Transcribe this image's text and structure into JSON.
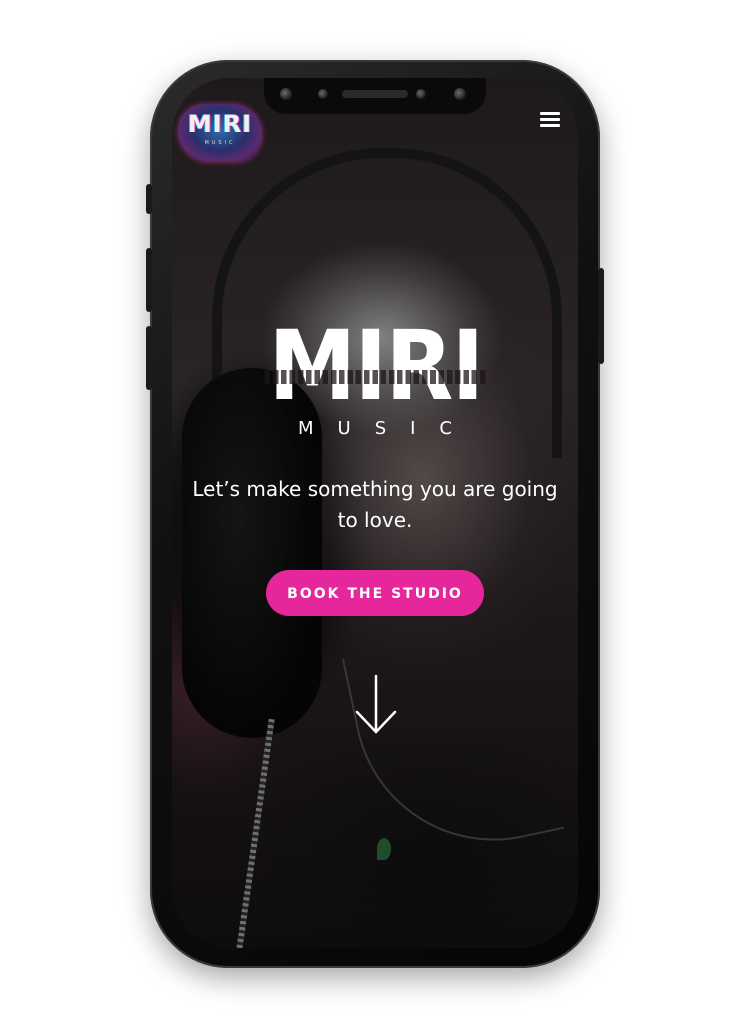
{
  "brand": {
    "logo_text": "MIRI",
    "logo_subtext": "MUSIC",
    "accent_color": "#e6279b"
  },
  "header": {
    "menu_icon": "hamburger-menu-icon"
  },
  "hero": {
    "title": "MIRI",
    "subtitle": "MUSIC",
    "tagline": "Let’s make something you are going to love.",
    "cta_label": "BOOK THE STUDIO",
    "scroll_icon": "arrow-down-icon"
  }
}
